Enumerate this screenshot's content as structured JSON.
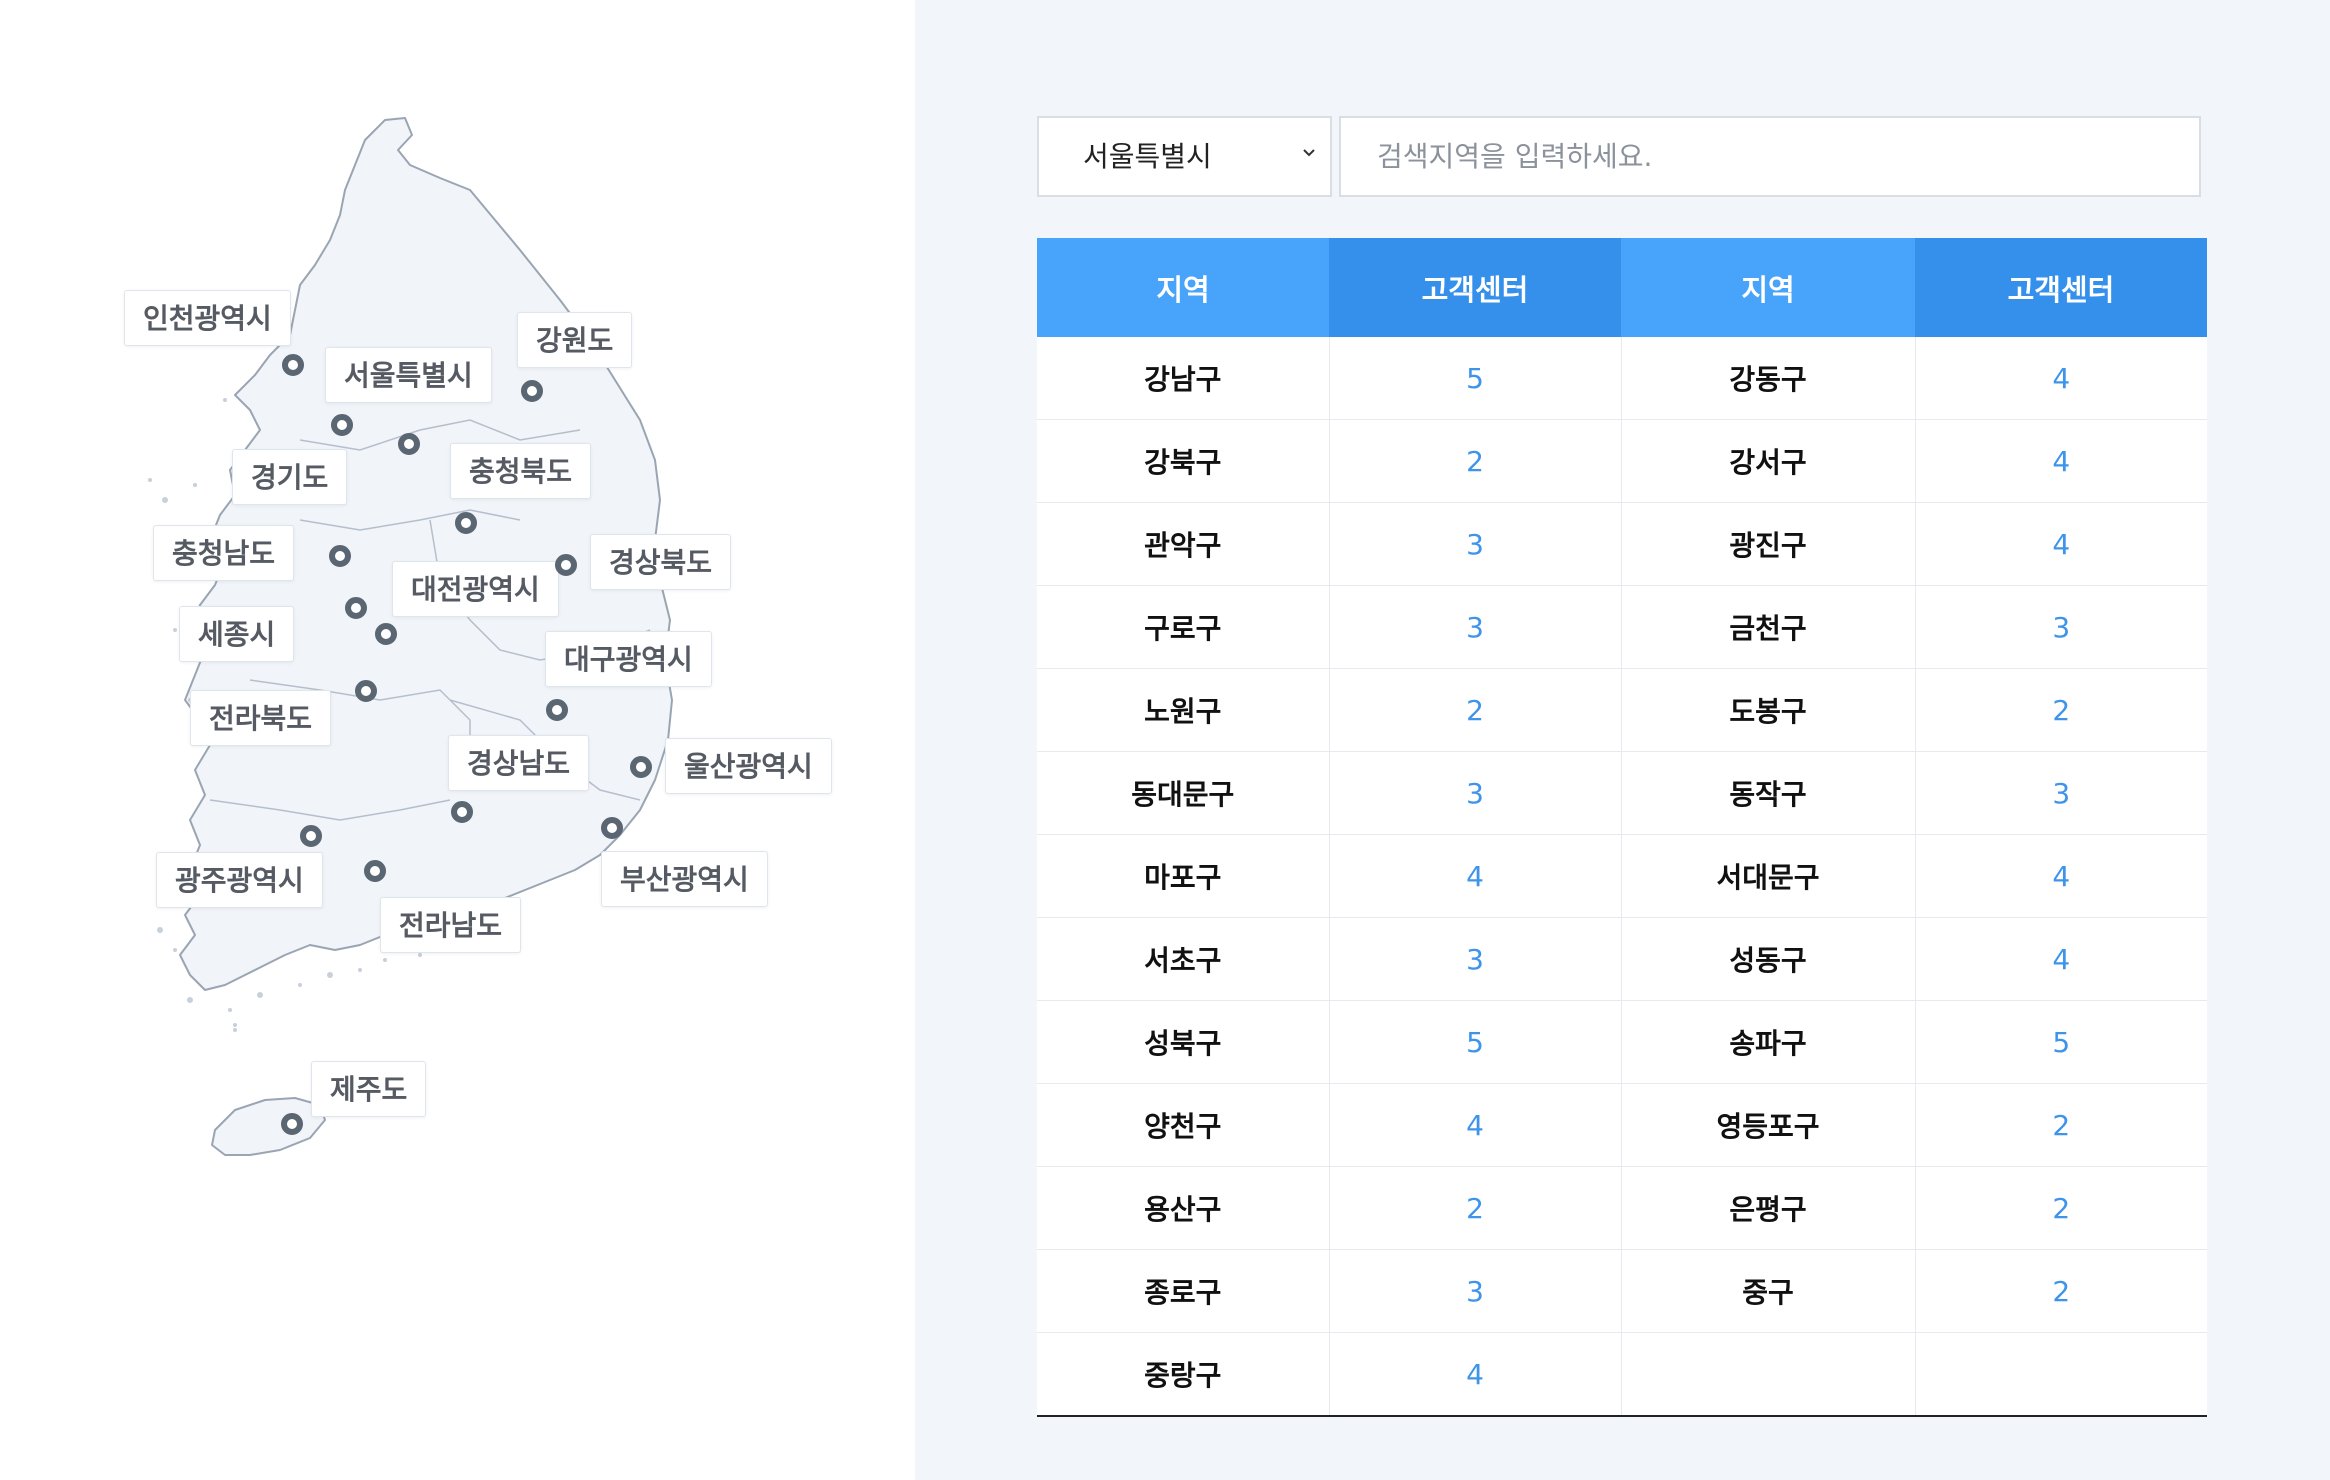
{
  "map": {
    "regions": [
      {
        "key": "incheon",
        "label": "인천광역시"
      },
      {
        "key": "seoul",
        "label": "서울특별시"
      },
      {
        "key": "gangwon",
        "label": "강원도"
      },
      {
        "key": "gyeonggi",
        "label": "경기도"
      },
      {
        "key": "chungbuk",
        "label": "충청북도"
      },
      {
        "key": "chungnam",
        "label": "충청남도"
      },
      {
        "key": "gyeongbuk",
        "label": "경상북도"
      },
      {
        "key": "daejeon",
        "label": "대전광역시"
      },
      {
        "key": "sejong",
        "label": "세종시"
      },
      {
        "key": "daegu",
        "label": "대구광역시"
      },
      {
        "key": "jeonbuk",
        "label": "전라북도"
      },
      {
        "key": "gyeongnam",
        "label": "경상남도"
      },
      {
        "key": "ulsan",
        "label": "울산광역시"
      },
      {
        "key": "gwangju",
        "label": "광주광역시"
      },
      {
        "key": "busan",
        "label": "부산광역시"
      },
      {
        "key": "jeonnam",
        "label": "전라남도"
      },
      {
        "key": "jeju",
        "label": "제주도"
      }
    ]
  },
  "search": {
    "selected_city": "서울특별시",
    "placeholder": "검색지역을 입력하세요."
  },
  "table": {
    "headers": [
      "지역",
      "고객센터",
      "지역",
      "고객센터"
    ],
    "rows": [
      [
        "강남구",
        "5",
        "강동구",
        "4"
      ],
      [
        "강북구",
        "2",
        "강서구",
        "4"
      ],
      [
        "관악구",
        "3",
        "광진구",
        "4"
      ],
      [
        "구로구",
        "3",
        "금천구",
        "3"
      ],
      [
        "노원구",
        "2",
        "도봉구",
        "2"
      ],
      [
        "동대문구",
        "3",
        "동작구",
        "3"
      ],
      [
        "마포구",
        "4",
        "서대문구",
        "4"
      ],
      [
        "서초구",
        "3",
        "성동구",
        "4"
      ],
      [
        "성북구",
        "5",
        "송파구",
        "5"
      ],
      [
        "양천구",
        "4",
        "영등포구",
        "2"
      ],
      [
        "용산구",
        "2",
        "은평구",
        "2"
      ],
      [
        "종로구",
        "3",
        "중구",
        "2"
      ],
      [
        "중랑구",
        "4",
        "",
        ""
      ]
    ]
  },
  "colors": {
    "header_region": "#48a3fb",
    "header_count": "#3490eb",
    "count_text": "#3d94ea",
    "panel_bg": "#f2f5f9"
  }
}
